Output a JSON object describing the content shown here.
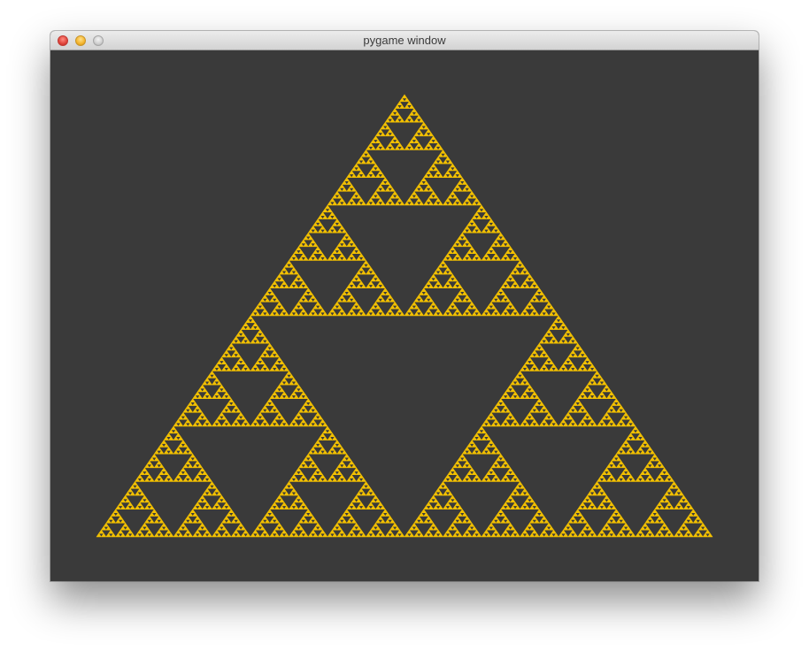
{
  "window": {
    "title": "pygame window"
  },
  "canvas": {
    "background_color": "#3a3a3a",
    "fractal": {
      "type": "sierpinski-triangle",
      "fill_color": "#f2c000",
      "hole_color": "#3a3a3a"
    }
  }
}
